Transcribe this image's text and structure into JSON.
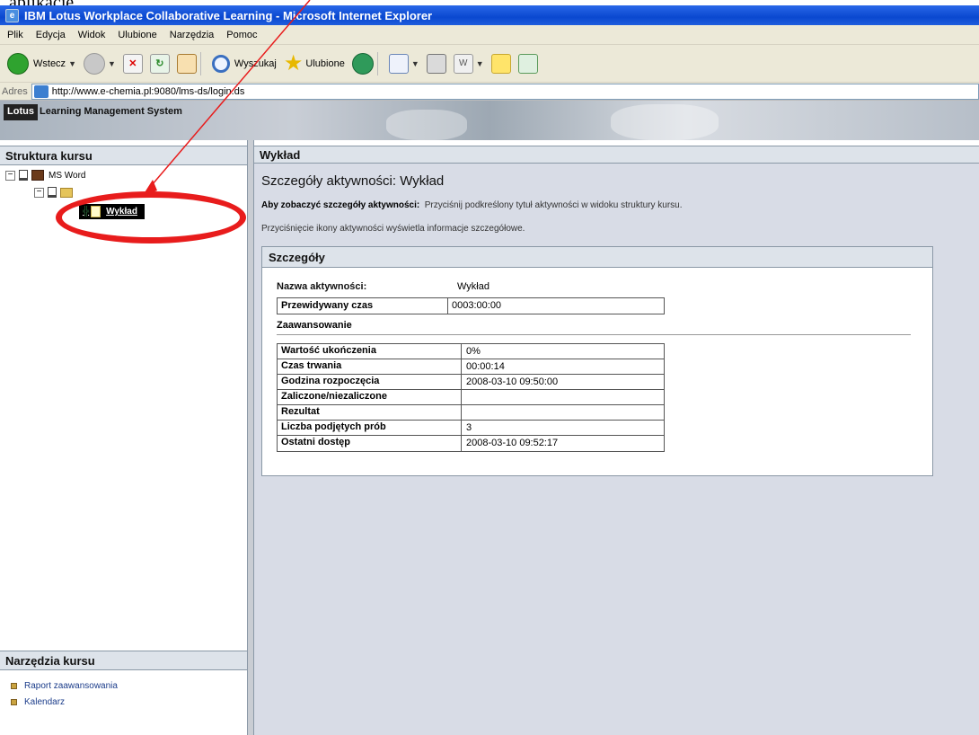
{
  "above_text": "aplikacje.",
  "window": {
    "title": "IBM Lotus Workplace Collaborative Learning - Microsoft Internet Explorer"
  },
  "menu": [
    "Plik",
    "Edycja",
    "Widok",
    "Ulubione",
    "Narzędzia",
    "Pomoc"
  ],
  "toolbar": {
    "back": "Wstecz",
    "search": "Wyszukaj",
    "favorites": "Ulubione"
  },
  "address": {
    "label": "Adres",
    "url": "http://www.e-chemia.pl:9080/lms-ds/login.ds"
  },
  "banner": {
    "logo": "Lotus",
    "title": "Learning Management System"
  },
  "left": {
    "structure_title": "Struktura kursu",
    "tree": {
      "course": "MS Word",
      "selected": "Wykład"
    },
    "tools_title": "Narzędzia kursu",
    "tools": [
      "Raport zaawansowania",
      "Kalendarz"
    ]
  },
  "main": {
    "header": "Wykład",
    "page_title": "Szczegóły aktywności: Wykład",
    "hint_bold": "Aby zobaczyć szczegóły aktywności:",
    "hint_text": "Przyciśnij podkreślony tytuł aktywności w widoku struktury kursu.",
    "hint2": "Przyciśnięcie ikony aktywności wyświetla informacje szczegółowe.",
    "card_title": "Szczegóły",
    "name_label": "Nazwa aktywności:",
    "name_value": "Wykład",
    "time_label": "Przewidywany czas",
    "time_value": "0003:00:00",
    "progress_title": "Zaawansowanie",
    "rows": [
      {
        "label": "Wartość ukończenia",
        "value": "0%"
      },
      {
        "label": "Czas trwania",
        "value": "00:00:14"
      },
      {
        "label": "Godzina rozpoczęcia",
        "value": "2008-03-10 09:50:00"
      },
      {
        "label": "Zaliczone/niezaliczone",
        "value": ""
      },
      {
        "label": "Rezultat",
        "value": ""
      },
      {
        "label": "Liczba podjętych prób",
        "value": "3"
      },
      {
        "label": "Ostatni dostęp",
        "value": "2008-03-10 09:52:17"
      }
    ]
  },
  "colors": {
    "annotation": "#e81c1c",
    "titlebar": "#0a48d0"
  }
}
